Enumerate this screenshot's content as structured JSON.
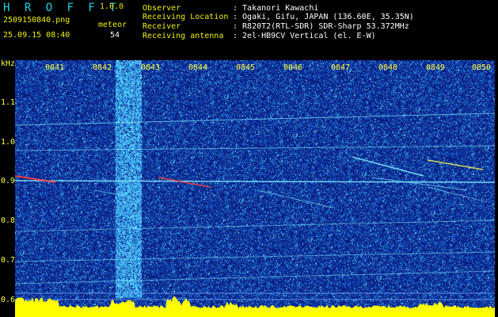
{
  "header": {
    "logo": "H R O F F T",
    "version": "1.0.0",
    "filename": "2509150840.png",
    "datetime": "25.09.15 08:40",
    "meteor_label": "meteor",
    "meteor_count": "54",
    "info": [
      {
        "label": "Observer",
        "value": ": Takanori Kawachi"
      },
      {
        "label": "Receiving Location",
        "value": ": Ogaki, Gifu, JAPAN (136.60E, 35.35N)"
      },
      {
        "label": "Receiver",
        "value": ": R820T2(RTL-SDR) SDR-Sharp 53.372MHz"
      },
      {
        "label": "Receiving antenna",
        "value": ": 2el-HB9CV Vertical (el. E-W)"
      }
    ]
  },
  "axis": {
    "unit": "kHz",
    "time_ticks": [
      "0841",
      "0842",
      "0843",
      "0844",
      "0845",
      "0846",
      "0847",
      "0848",
      "0849",
      "0850"
    ],
    "freq_ticks": [
      "1.1",
      "1.0",
      "0.9",
      "0.8",
      "0.7",
      "0.6"
    ]
  },
  "colors": {
    "background": "#0a1a7a",
    "noise_cyan": "#30c8ff",
    "line_cyan": "#7fe6ff",
    "echo_red": "#ff4040",
    "echo_yellow": "#ffff40",
    "bar_yellow": "#ffff00",
    "text_yellow": "#f0f000",
    "logo_cyan": "#1fd2e6"
  }
}
